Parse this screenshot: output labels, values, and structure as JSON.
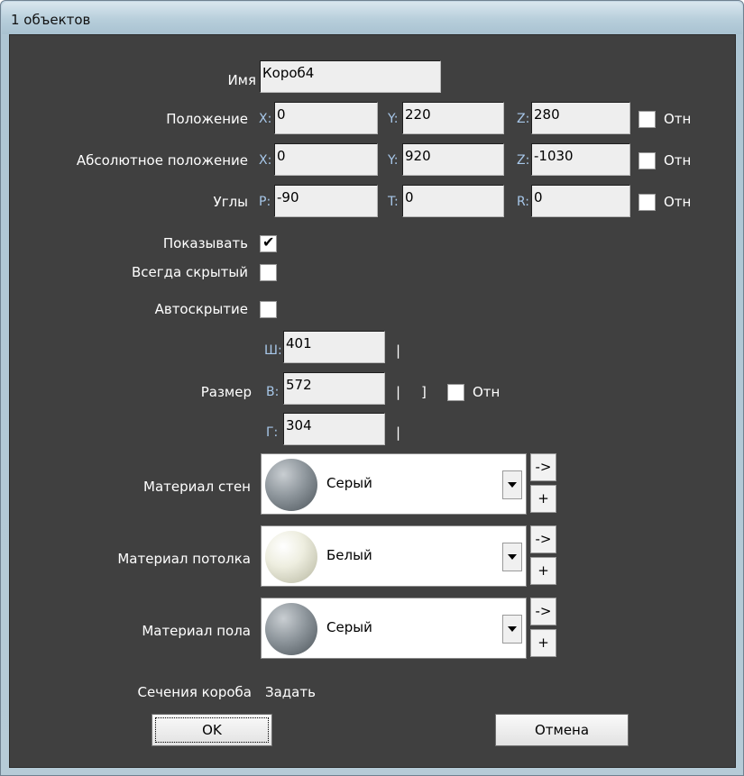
{
  "window": {
    "title": "1 объектов"
  },
  "name": {
    "label": "Имя",
    "value": "Короб4"
  },
  "position": {
    "label": "Положение",
    "x_label": "X:",
    "x": "0",
    "y_label": "Y:",
    "y": "220",
    "z_label": "Z:",
    "z": "280",
    "rel_label": "Отн",
    "rel_checked": false
  },
  "abs_position": {
    "label": "Абсолютное положение",
    "x_label": "X:",
    "x": "0",
    "y_label": "Y:",
    "y": "920",
    "z_label": "Z:",
    "z": "-1030",
    "rel_label": "Отн",
    "rel_checked": false
  },
  "angles": {
    "label": "Углы",
    "p_label": "P:",
    "p": "-90",
    "t_label": "T:",
    "t": "0",
    "r_label": "R:",
    "r": "0",
    "rel_label": "Отн",
    "rel_checked": false
  },
  "show": {
    "label": "Показывать",
    "checked": true,
    "check_glyph": "✔"
  },
  "always_hidden": {
    "label": "Всегда скрытый",
    "checked": false
  },
  "autohide": {
    "label": "Автоскрытие",
    "checked": false
  },
  "size": {
    "label": "Размер",
    "w_label": "Ш:",
    "w": "401",
    "h_label": "В:",
    "h": "572",
    "d_label": "Г:",
    "d": "304",
    "bar": "|",
    "bracket": "]",
    "rel_label": "Отн",
    "rel_checked": false
  },
  "materials": {
    "walls": {
      "label": "Материал стен",
      "name": "Серый",
      "sphere": "grey"
    },
    "ceiling": {
      "label": "Материал потолка",
      "name": "Белый",
      "sphere": "white"
    },
    "floor": {
      "label": "Материал пола",
      "name": "Серый",
      "sphere": "grey"
    },
    "arrow_label": "->",
    "plus_label": "+"
  },
  "sections": {
    "label": "Сечения короба",
    "action": "Задать"
  },
  "buttons": {
    "ok": "OK",
    "cancel": "Отмена"
  },
  "colors": {
    "panel": "#404040",
    "axis_label": "#a8c8ea",
    "field_bg": "#eeeeee"
  },
  "icons": {
    "dropdown": "chevron-down-icon",
    "sphere": "material-sphere-icon"
  }
}
